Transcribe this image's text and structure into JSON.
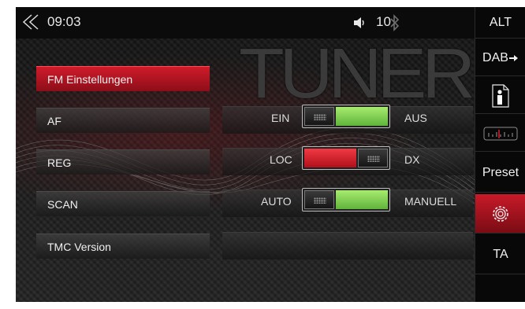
{
  "status": {
    "time": "09:03",
    "volume": "10"
  },
  "watermark": "TUNER",
  "menu": {
    "fm_settings": "FM Einstellungen",
    "af": "AF",
    "reg": "REG",
    "scan": "SCAN",
    "tmc_version": "TMC Version"
  },
  "toggles": [
    {
      "left": "EIN",
      "right": "AUS",
      "state": "right",
      "color": "#8be05a"
    },
    {
      "left": "LOC",
      "right": "DX",
      "state": "left",
      "color": "#d91f2c"
    },
    {
      "left": "AUTO",
      "right": "MANUELL",
      "state": "right",
      "color": "#8be05a"
    }
  ],
  "sidebar": {
    "alt": "ALT",
    "dab": "DAB",
    "info_icon": "info-icon",
    "frequency_icon": "frequency-scale-icon",
    "preset": "Preset",
    "settings_icon": "gear-icon",
    "ta": "TA"
  },
  "colors": {
    "accent_red": "#c91a28",
    "toggle_green": "#8be05a"
  }
}
